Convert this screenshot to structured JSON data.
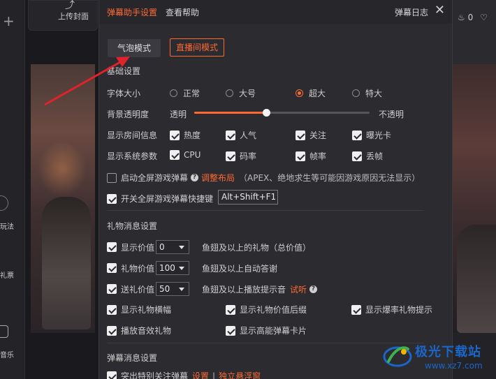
{
  "background": {
    "upload_label": "上传封面",
    "sidebar_labels": [
      "玩法",
      "礼票",
      "音乐"
    ],
    "likes_count": "0"
  },
  "header": {
    "tab_settings": "弹幕助手设置",
    "tab_help": "查看帮助",
    "log_label": "弹幕日志",
    "close_glyph": "✕"
  },
  "modes": {
    "bubble": "气泡模式",
    "live_room": "直播间模式"
  },
  "basic": {
    "title": "基础设置",
    "font_size": {
      "label": "字体大小",
      "options": [
        "正常",
        "大号",
        "超大",
        "特大"
      ],
      "selected": "超大"
    },
    "opacity": {
      "label": "背景透明度",
      "min_label": "透明",
      "max_label": "不透明",
      "value_fraction": 0.41
    },
    "room_info": {
      "label": "显示房间信息",
      "items": [
        "热度",
        "人气",
        "关注",
        "曝光卡"
      ]
    },
    "system_params": {
      "label": "显示系统参数",
      "items": [
        "CPU",
        "码率",
        "帧率",
        "丢帧"
      ]
    },
    "fullscreen": {
      "label": "启动全屏游戏弹幕",
      "link": "调整布局",
      "note": "（APEX、绝地求生等可能因游戏原因无法显示）"
    },
    "hotkey": {
      "label": "开关全屏游戏弹幕快捷键",
      "value": "Alt+Shift+F1"
    }
  },
  "gift": {
    "title": "礼物消息设置",
    "show_value": {
      "label": "显示价值",
      "value": "0",
      "suffix": "鱼翅及以上的礼物（总价值）"
    },
    "gift_value": {
      "label": "礼物价值",
      "value": "100",
      "suffix": "鱼翅及以上自动答谢"
    },
    "send_value": {
      "label": "送礼价值",
      "value": "50",
      "suffix": "鱼翅及以上播放提示音",
      "link": "试听"
    },
    "options_row1": [
      "显示礼物横幅",
      "显示礼物价值后缀",
      "显示爆率礼物提示"
    ],
    "options_row2": [
      "播放音效礼物",
      "显示高能弹幕卡片"
    ]
  },
  "danmaku": {
    "title": "弹幕消息设置",
    "highlight_label": "突出特别关注弹幕",
    "link_settings": "设置",
    "separator": "|",
    "link_float": "独立悬浮窗"
  },
  "watermark": {
    "title": "极光下载站",
    "url": "www.xz7.com"
  },
  "colors": {
    "accent": "#ff6a33",
    "panel": "#2b2b30",
    "arrow": "#e0232a"
  }
}
